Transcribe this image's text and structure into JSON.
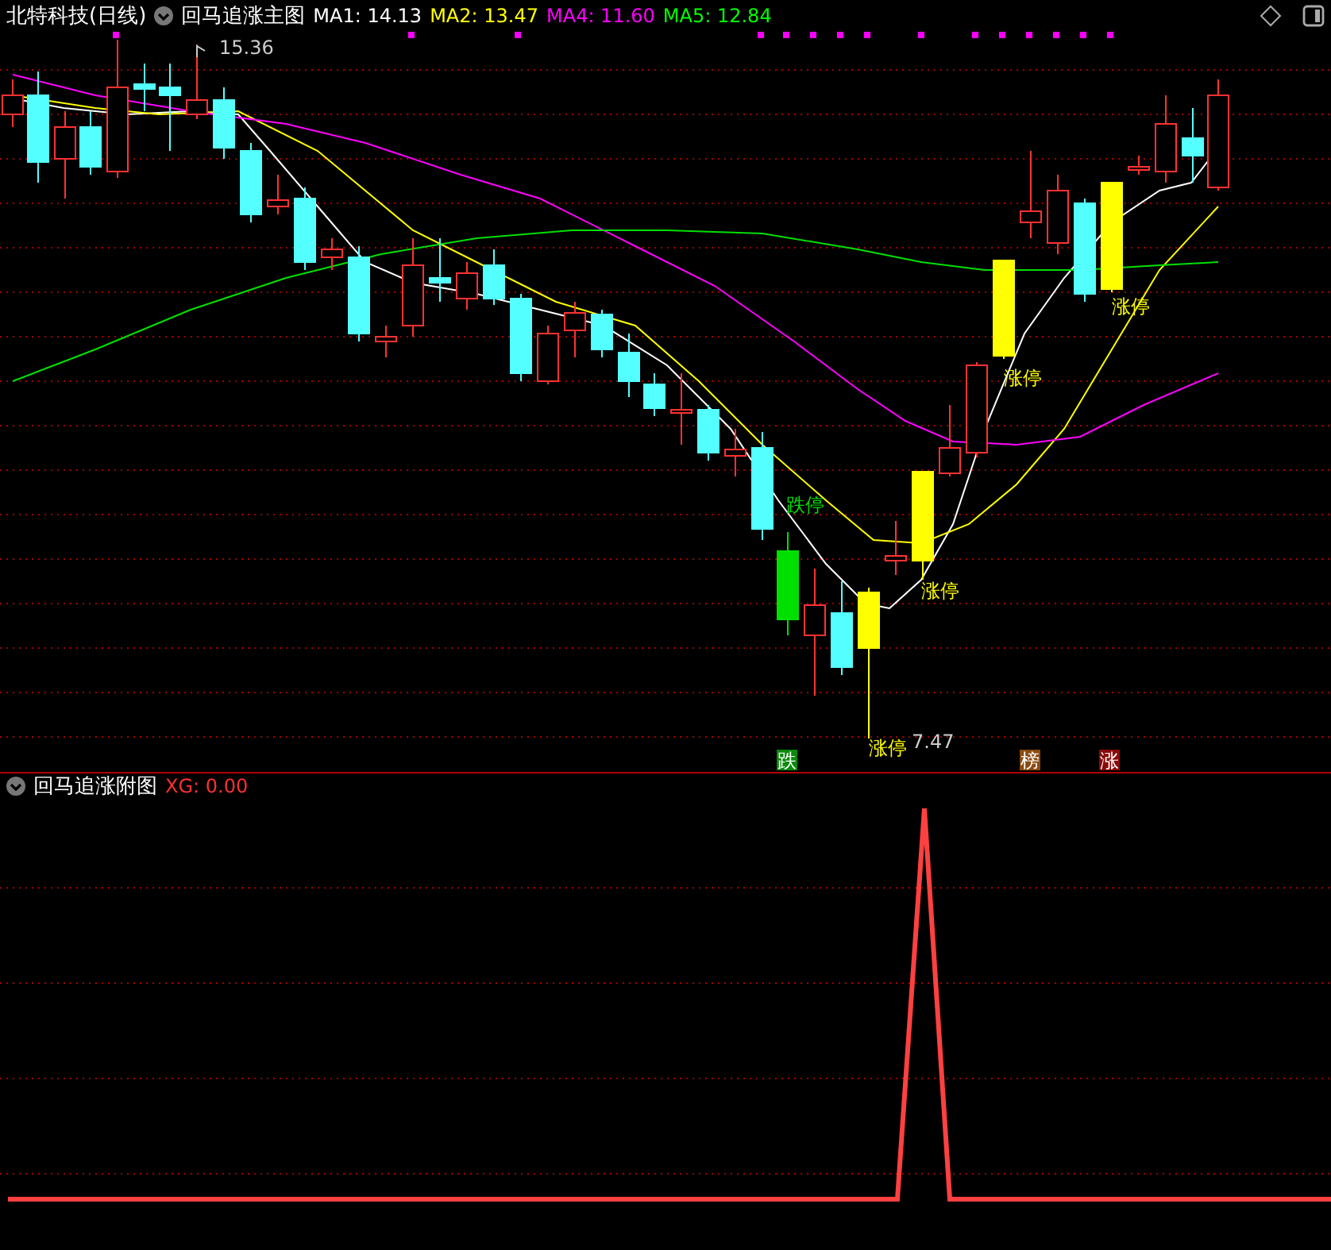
{
  "header": {
    "stock": "北特科技(日线)",
    "indicator": "回马追涨主图",
    "ma": [
      {
        "text": "MA1: 14.13",
        "color": "#ffffff"
      },
      {
        "text": "MA2: 13.47",
        "color": "#ffff00"
      },
      {
        "text": "MA4: 11.60",
        "color": "#ff00ff"
      },
      {
        "text": "MA5: 12.84",
        "color": "#00ff00"
      }
    ]
  },
  "main_chart": {
    "high_label": "15.36",
    "low_label": "7.47",
    "limit_labels": [
      {
        "text": "跌停",
        "kind": "down"
      },
      {
        "text": "涨停",
        "kind": "up"
      },
      {
        "text": "涨停",
        "kind": "up"
      },
      {
        "text": "涨停",
        "kind": "up"
      },
      {
        "text": "涨停",
        "kind": "up"
      }
    ],
    "signal_tags": [
      {
        "text": "跌",
        "color": "#0a8a0a"
      },
      {
        "text": "榜",
        "color": "#8b4a10"
      },
      {
        "text": "涨",
        "color": "#8b0a0a"
      }
    ]
  },
  "sub_chart": {
    "title": "回马追涨附图",
    "xg": "XG: 0.00"
  }
}
